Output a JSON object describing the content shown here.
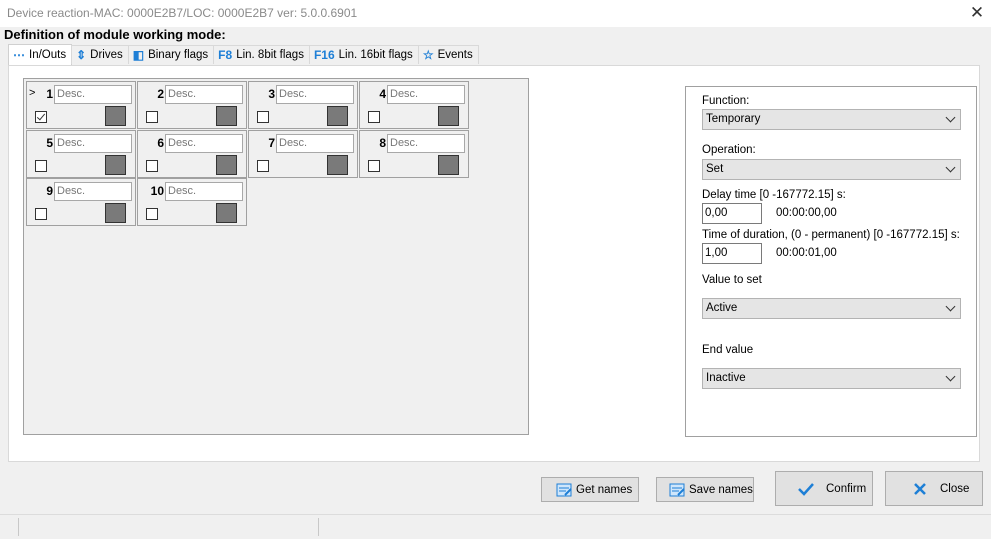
{
  "window": {
    "title": "Device reaction-MAC: 0000E2B7/LOC: 0000E2B7 ver: 5.0.0.6901"
  },
  "heading": "Definition of module working mode:",
  "tabs": [
    {
      "label": "In/Outs"
    },
    {
      "label": "Drives"
    },
    {
      "label": "Binary flags"
    },
    {
      "label": "Lin. 8bit flags"
    },
    {
      "label": "Lin. 16bit flags"
    },
    {
      "label": "Events"
    }
  ],
  "grid": {
    "pointer": ">",
    "cells": [
      {
        "num": "1",
        "desc": "Desc.",
        "checked": true
      },
      {
        "num": "2",
        "desc": "Desc.",
        "checked": false
      },
      {
        "num": "3",
        "desc": "Desc.",
        "checked": false
      },
      {
        "num": "4",
        "desc": "Desc.",
        "checked": false
      },
      {
        "num": "5",
        "desc": "Desc.",
        "checked": false
      },
      {
        "num": "6",
        "desc": "Desc.",
        "checked": false
      },
      {
        "num": "7",
        "desc": "Desc.",
        "checked": false
      },
      {
        "num": "8",
        "desc": "Desc.",
        "checked": false
      },
      {
        "num": "9",
        "desc": "Desc.",
        "checked": false
      },
      {
        "num": "10",
        "desc": "Desc.",
        "checked": false
      }
    ]
  },
  "panel": {
    "function_label": "Function:",
    "function_value": "Temporary",
    "operation_label": "Operation:",
    "operation_value": "Set",
    "delay_label": "Delay time [0 -167772.15] s:",
    "delay_value": "0,00",
    "delay_time": "00:00:00,00",
    "duration_label": "Time of duration, (0 - permanent) [0 -167772.15] s:",
    "duration_value": "1,00",
    "duration_time": "00:00:01,00",
    "value_label": "Value to set",
    "value_value": "Active",
    "end_label": "End value",
    "end_value": "Inactive"
  },
  "buttons": {
    "get_names": "Get names",
    "save_names": "Save names",
    "confirm": "Confirm",
    "close": "Close"
  },
  "colors": {
    "accent": "#1e7fd6",
    "confirm_icon": "#1e7fd6",
    "close_icon": "#1e7fd6"
  }
}
